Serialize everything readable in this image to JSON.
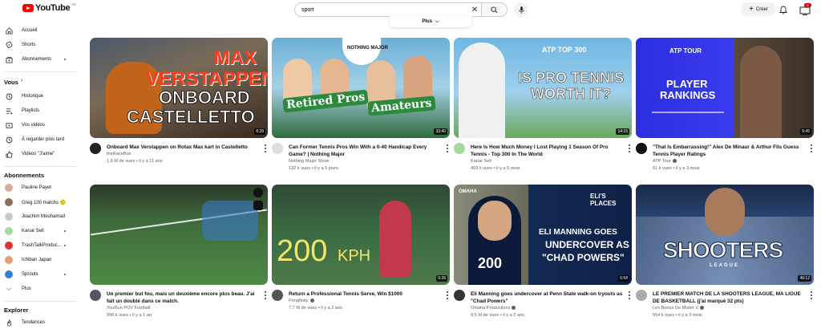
{
  "header": {
    "logo": "YouTube",
    "logo_region": "FR",
    "search_value": "sport",
    "create_label": "Créer",
    "notif_count": "9+",
    "more_filter": "Plus"
  },
  "sidebar": {
    "main": [
      {
        "label": "Accueil",
        "icon": "home-icon"
      },
      {
        "label": "Shorts",
        "icon": "shorts-icon"
      },
      {
        "label": "Abonnements",
        "icon": "subscriptions-icon"
      }
    ],
    "you_header": "Vous",
    "you": [
      {
        "label": "Historique",
        "icon": "history-icon"
      },
      {
        "label": "Playlists",
        "icon": "playlist-icon"
      },
      {
        "label": "Vos vidéos",
        "icon": "video-icon"
      },
      {
        "label": "À regarder plus tard",
        "icon": "watch-later-icon"
      },
      {
        "label": "Vidéos \"J'aime\"",
        "icon": "like-icon"
      }
    ],
    "subs_header": "Abonnements",
    "subs": [
      {
        "label": "Pauline Payet",
        "color": "#d9a9a0",
        "dot": false
      },
      {
        "label": "Greg 100 matchs 🥎",
        "color": "#8a6c5a",
        "dot": false
      },
      {
        "label": "Joachim Mouhamad",
        "color": "#c9c9c9",
        "dot": false
      },
      {
        "label": "Karue Sell",
        "color": "#a6d9a0",
        "dot": true
      },
      {
        "label": "TrashTalkProduc...",
        "color": "#d33",
        "dot": true
      },
      {
        "label": "Ichiban Japan",
        "color": "#e0a070",
        "dot": false
      },
      {
        "label": "Sprouts",
        "color": "#3a7bd5",
        "dot": true
      },
      {
        "label": "Plus",
        "color": "",
        "dot": false
      }
    ],
    "explore_header": "Explorer",
    "explore": [
      {
        "label": "Tendances",
        "icon": "trending-icon"
      }
    ]
  },
  "videos": [
    {
      "title": "Onboard Max Verstappen on Rotax Max kart in Castelletto",
      "channel": "theRaceBox",
      "verified": false,
      "meta": "1,9 M de vues • il y a 11 ans",
      "duration": "8:28",
      "thumb_text": [
        "MAX",
        "VERSTAPPEN",
        "ONBOARD",
        "CASTELLETTO"
      ],
      "av_color": "#222"
    },
    {
      "title": "Can Former Tennis Pros Win With a 0-40 Handicap Every Game? | Nothing Major",
      "channel": "Nothing Major Show",
      "verified": false,
      "meta": "132 k vues • il y a 5 jours",
      "duration": "33:40",
      "thumb_text": [
        "Retired Pros",
        "Amateurs",
        "NOTHING MAJOR"
      ],
      "av_color": "#ddd"
    },
    {
      "title": "Here Is How Much Money I Lost Playing 1 Season Of Pro Tennis - Top 300 In The World",
      "channel": "Karue Sell",
      "verified": false,
      "meta": "403 k vues • il y a 5 mois",
      "duration": "14:15",
      "thumb_text": [
        "ATP TOP 300",
        "IS PRO TENNIS",
        "WORTH IT?"
      ],
      "av_color": "#a6d9a0"
    },
    {
      "title": "\"That Is Embarrassing!\" Alex De Minaur & Arthur Fils Guess Tennis Player Ratings",
      "channel": "ATP Tour",
      "verified": true,
      "meta": "61 k vues • il y a 3 mois",
      "duration": "6:45",
      "thumb_text": [
        "ATP TOUR",
        "PLAYER",
        "RANKINGS"
      ],
      "av_color": "#111"
    },
    {
      "title": "Un premier but fou, mais un deuxième encore plus beau. J'ai fait un doublé dans ce match.",
      "channel": "YouRun POV Football",
      "verified": false,
      "meta": "996 k vues • il y a 1 an",
      "duration": "",
      "thumb_text": [],
      "av_color": "#556"
    },
    {
      "title": "Return a Professional Tennis Serve, Win $1000",
      "channel": "Pongfinity",
      "verified": true,
      "meta": "7,7 M de vues • il y a 2 ans",
      "duration": "9:26",
      "thumb_text": [
        "200",
        "KPH"
      ],
      "av_color": "#555"
    },
    {
      "title": "Eli Manning goes undercover at Penn State walk-on tryouts as \"Chad Powers\"",
      "channel": "Omaha Productions",
      "verified": true,
      "meta": "9,5 M de vues • il y a 2 ans",
      "duration": "6:58",
      "thumb_text": [
        "ELI MANNING GOES",
        "UNDERCOVER AS",
        "\"CHAD POWERS\"",
        "ELI'S PLACES",
        "OMAHA"
      ],
      "av_color": "#333"
    },
    {
      "title": "LE PREMIER MATCH DE LA SHOOTERS LEAGUE, MA LIGUE DE BASKETBALL (j'ai marqué 32 pts)",
      "channel": "Les Bonus De Mister V",
      "verified": true,
      "meta": "554 k vues • il y a 3 mois",
      "duration": "49:12",
      "thumb_text": [
        "SHOOTERS",
        "LEAGUE"
      ],
      "av_color": "#aaa"
    }
  ]
}
